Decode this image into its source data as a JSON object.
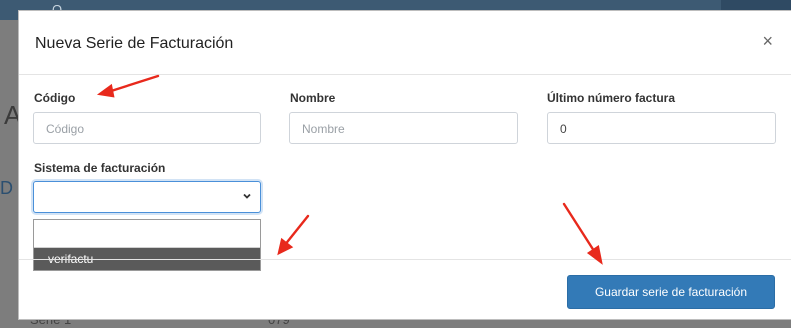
{
  "background": {
    "search_glyph": "Q",
    "letter_a": "A",
    "letter_d": "D",
    "row_name": "Serie 1",
    "row_value": "079"
  },
  "modal": {
    "title": "Nueva Serie de Facturación",
    "close_glyph": "×",
    "fields": {
      "codigo": {
        "label": "Código",
        "placeholder": "Código",
        "value": ""
      },
      "nombre": {
        "label": "Nombre",
        "placeholder": "Nombre",
        "value": ""
      },
      "ultimo": {
        "label": "Último número factura",
        "placeholder": "",
        "value": "0"
      }
    },
    "sistema": {
      "label": "Sistema de facturación",
      "selected": "",
      "options": [
        "verifactu"
      ]
    },
    "save_label": "Guardar serie de facturación"
  },
  "colors": {
    "primary_button": "#337ab7",
    "focus_border": "#4a90d9",
    "annotation_arrow": "#e8291c",
    "highlighted_option": "#5a5a5a"
  },
  "icons": {
    "close": "close-icon",
    "chevron": "chevron-down-icon",
    "arrow": "red-arrow-annotation"
  }
}
